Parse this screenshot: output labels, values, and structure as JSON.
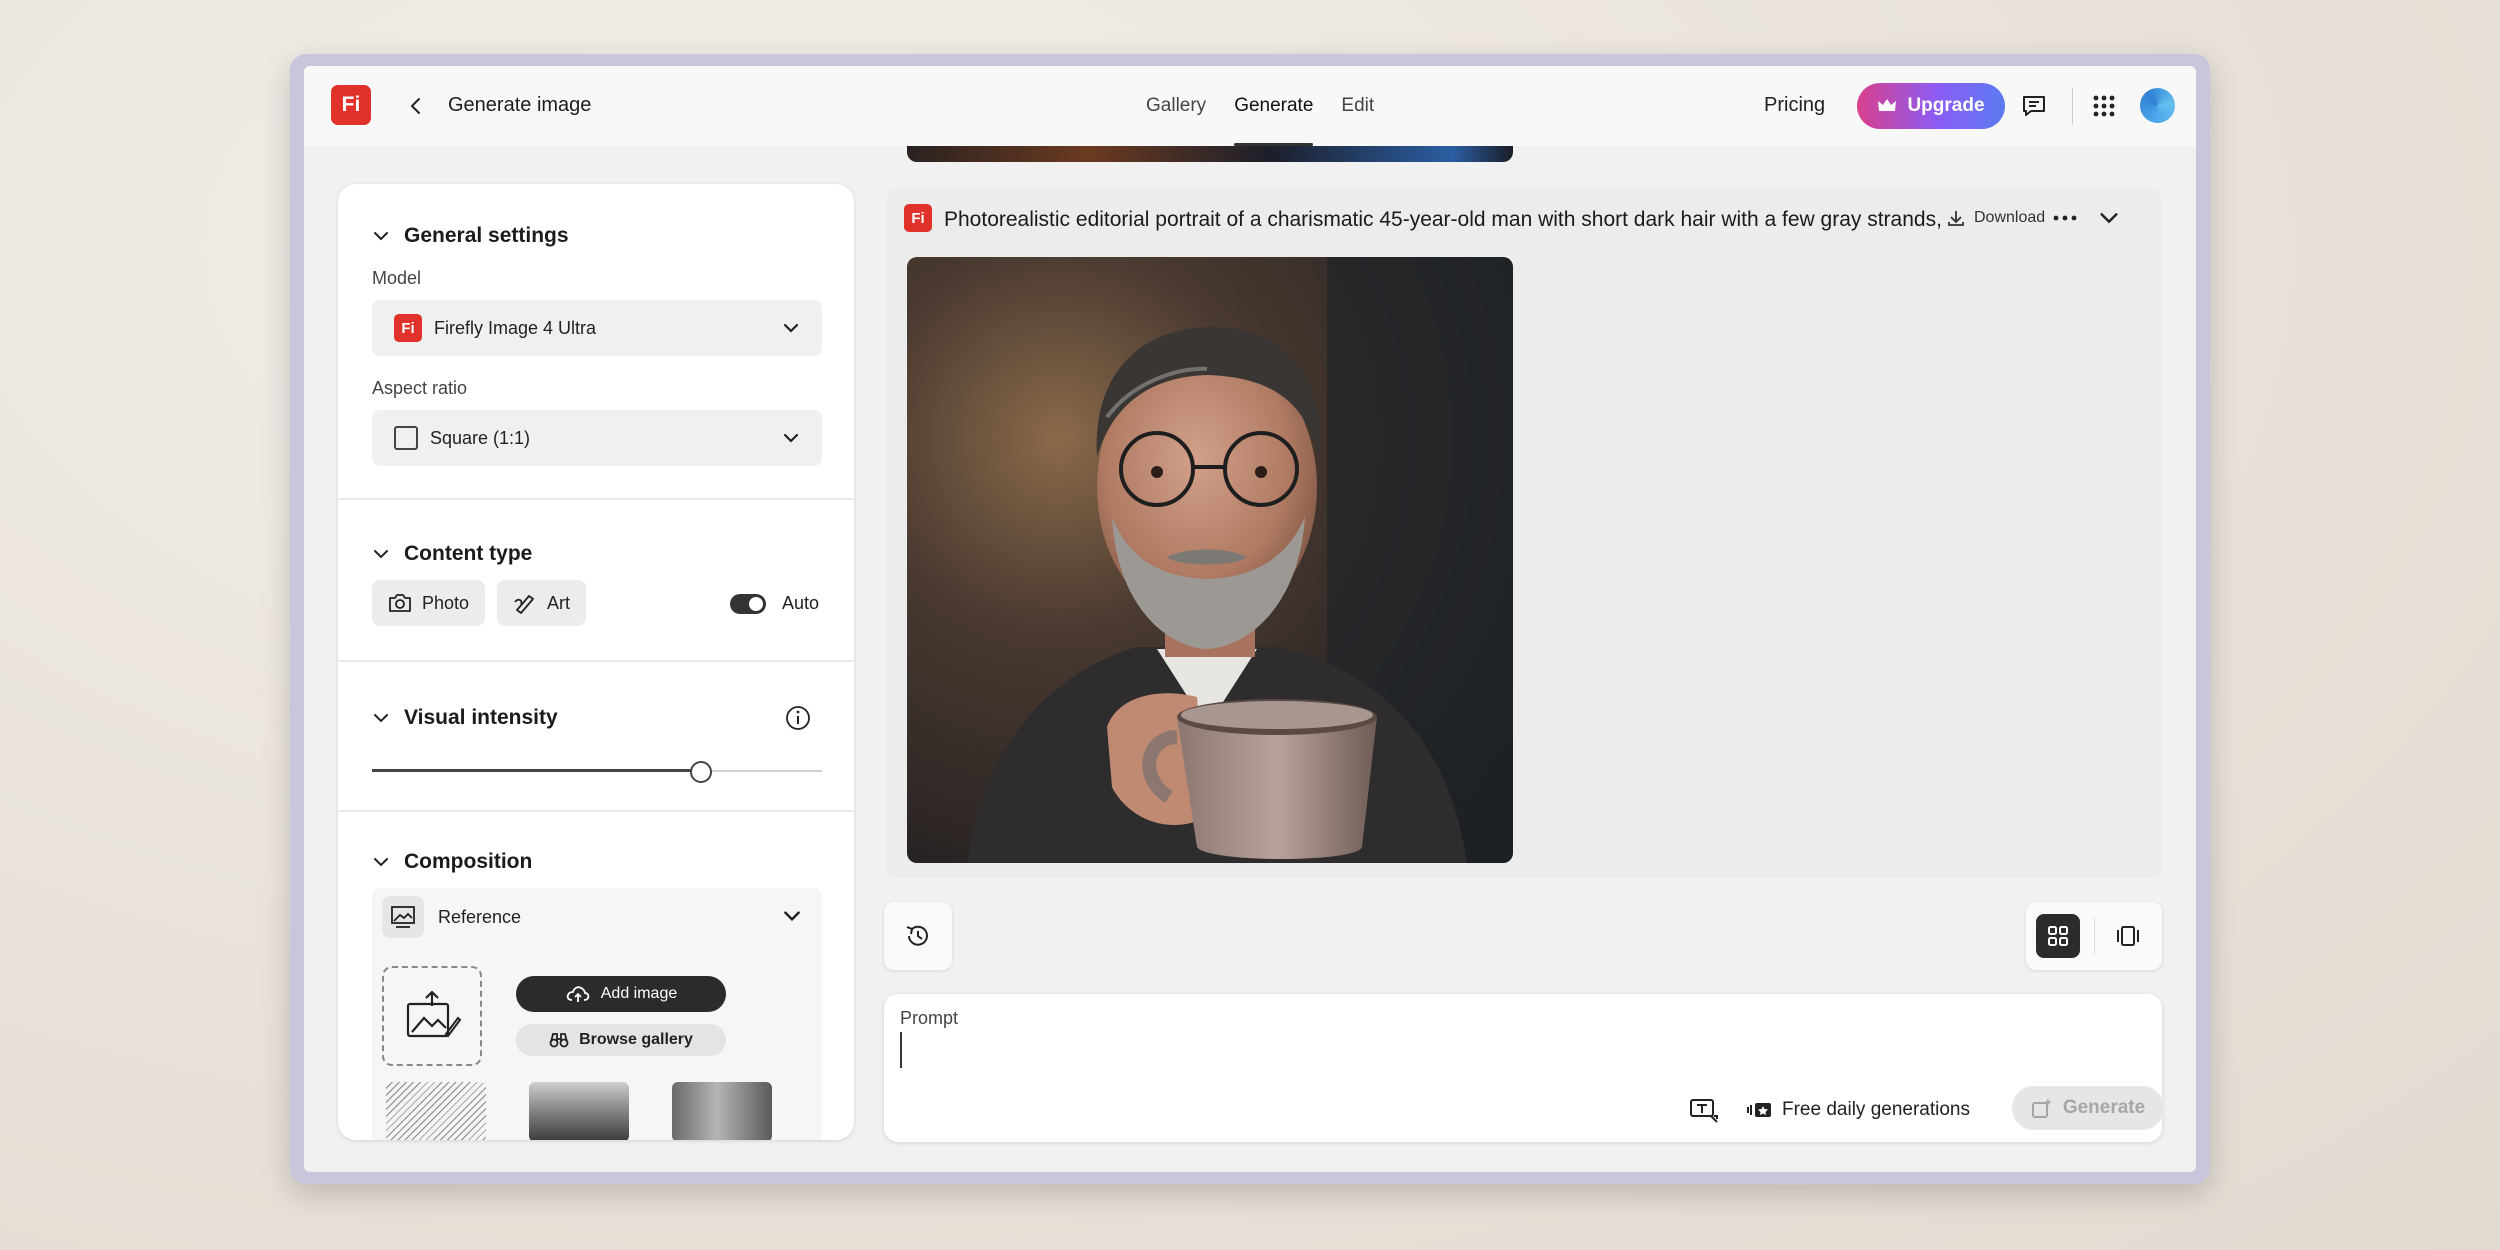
{
  "header": {
    "logo": "Fi",
    "back_icon": "chevron-left-icon",
    "title": "Generate image",
    "tabs": [
      {
        "label": "Gallery",
        "active": false
      },
      {
        "label": "Generate",
        "active": true
      },
      {
        "label": "Edit",
        "active": false
      }
    ],
    "pricing": "Pricing",
    "upgrade": "Upgrade",
    "upgrade_icon": "crown-icon",
    "accent_gradient": [
      "#d9408c",
      "#8b5cf6",
      "#5b7bf0"
    ]
  },
  "settings": {
    "general": {
      "title": "General settings",
      "model_label": "Model",
      "model_value": "Firefly Image 4 Ultra",
      "model_logo": "Fi",
      "aspect_label": "Aspect ratio",
      "aspect_value": "Square (1:1)"
    },
    "content_type": {
      "title": "Content type",
      "options": [
        "Photo",
        "Art"
      ],
      "auto_label": "Auto",
      "auto_enabled": true
    },
    "visual_intensity": {
      "title": "Visual intensity",
      "value_percent": 73
    },
    "composition": {
      "title": "Composition",
      "reference_label": "Reference",
      "add_image": "Add image",
      "browse_gallery": "Browse gallery"
    }
  },
  "result": {
    "logo": "Fi",
    "prompt": "Photorealistic editorial portrait of a charismatic 45-year-old man with short dark hair with a few gray strands,",
    "download": "Download"
  },
  "prompt_box": {
    "label": "Prompt",
    "value": "",
    "free_label": "Free daily generations",
    "generate": "Generate"
  },
  "colors": {
    "brand_red": "#e0312a",
    "dark": "#2b2b2b"
  }
}
